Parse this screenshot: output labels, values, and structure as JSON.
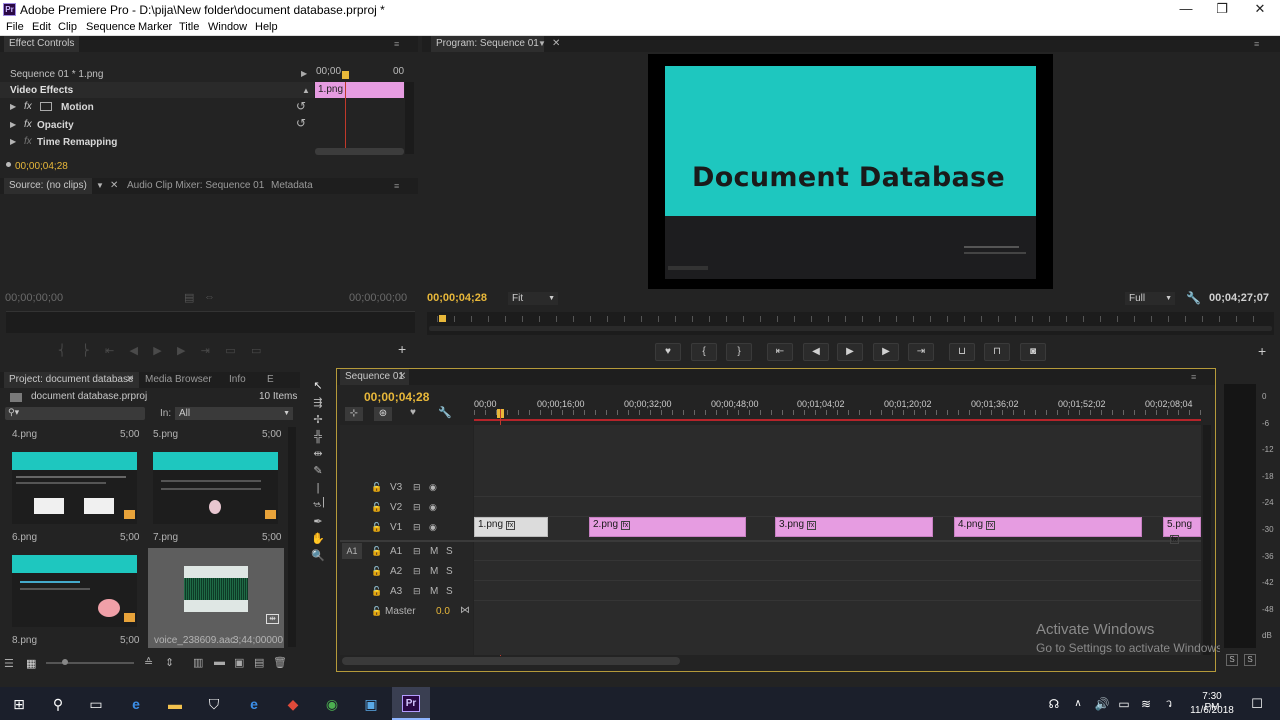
{
  "window": {
    "title": "Adobe Premiere Pro - D:\\pija\\New folder\\document database.prproj *",
    "app_icon": "Pr",
    "minimize": "—",
    "maximize": "❐",
    "close": "✕"
  },
  "menu": [
    "File",
    "Edit",
    "Clip",
    "Sequence",
    "Marker",
    "Title",
    "Window",
    "Help"
  ],
  "effect_controls": {
    "tab": "Effect Controls",
    "sequence_label": "Sequence 01 * 1.png",
    "ruler_start": "00;00",
    "ruler_end": "00",
    "clip_label": "1.png",
    "section": "Video Effects",
    "effects": [
      "Motion",
      "Opacity",
      "Time Remapping"
    ],
    "timecode": "00;00;04;28"
  },
  "source_panel": {
    "tabs": [
      "Source: (no clips)",
      "Audio Clip Mixer: Sequence 01",
      "Metadata"
    ],
    "timecode_left": "00;00;00;00",
    "timecode_right": "00;00;00;00"
  },
  "program_monitor": {
    "tab": "Program: Sequence 01",
    "slide_title": "Document Database",
    "timecode": "00;00;04;28",
    "fit": "Fit",
    "quality": "Full",
    "duration": "00;04;27;07"
  },
  "project": {
    "tabs": [
      "Project: document database",
      "Media Browser",
      "Info",
      "E"
    ],
    "file": "document database.prproj",
    "items_count": "10 Items",
    "in_label": "In:",
    "in_value": "All",
    "thumbs": [
      {
        "name": "4.png",
        "duration": "5;00"
      },
      {
        "name": "5.png",
        "duration": "5;00"
      },
      {
        "name": "6.png",
        "duration": "5;00"
      },
      {
        "name": "7.png",
        "duration": "5;00"
      },
      {
        "name": "8.png",
        "duration": "5;00"
      },
      {
        "name": "voice_238609.aac",
        "duration": "3;44;00000"
      }
    ]
  },
  "timeline": {
    "tab": "Sequence 01",
    "timecode": "00;00;04;28",
    "ruler": [
      "00;00",
      "00;00;16;00",
      "00;00;32;00",
      "00;00;48;00",
      "00;01;04;02",
      "00;01;20;02",
      "00;01;36;02",
      "00;01;52;02",
      "00;02;08;04"
    ],
    "video_tracks": [
      "V3",
      "V2",
      "V1"
    ],
    "audio_tracks": [
      "A1",
      "A2",
      "A3"
    ],
    "source_patch": "A1",
    "master_label": "Master",
    "master_value": "0.0",
    "mute": "M",
    "solo": "S",
    "clips": [
      "1.png",
      "2.png",
      "3.png",
      "4.png",
      "5.png"
    ]
  },
  "audio_meter": {
    "ticks": [
      "0",
      "-6",
      "-12",
      "-18",
      "-24",
      "-30",
      "-36",
      "-42",
      "-48",
      "dB"
    ],
    "solo_left": "S",
    "solo_right": "S"
  },
  "watermark": {
    "line1": "Activate Windows",
    "line2": "Go to Settings to activate Windows."
  },
  "taskbar": {
    "time": "7:30 PM",
    "date": "11/6/2018",
    "pr_label": "Pr"
  }
}
